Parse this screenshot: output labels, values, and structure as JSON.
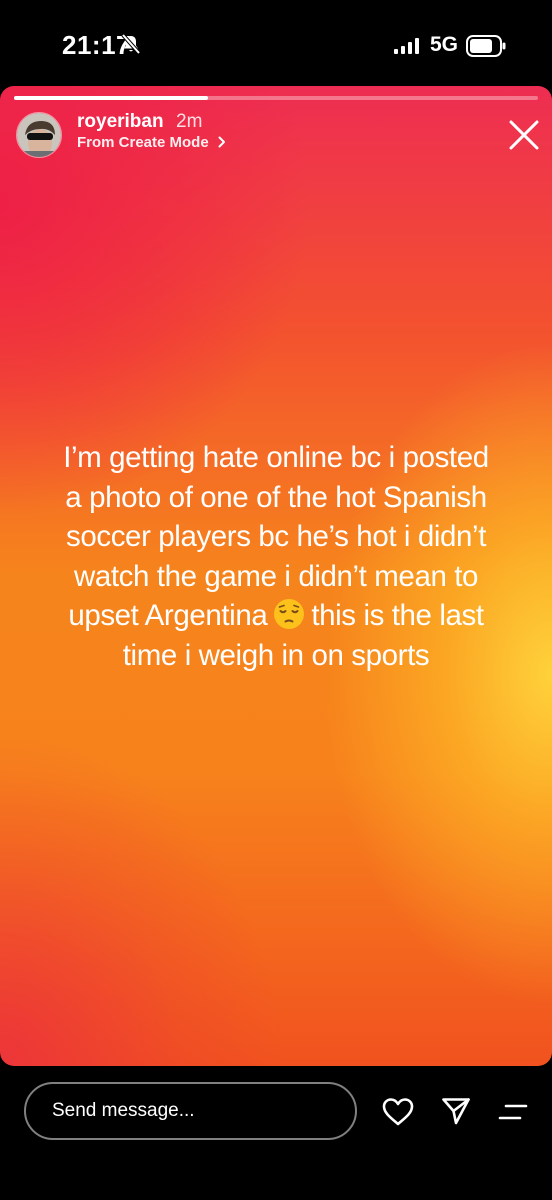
{
  "status_bar": {
    "time": "21:17",
    "network": "5G",
    "icons": [
      "bell-slash-icon",
      "signal-icon",
      "battery-icon"
    ]
  },
  "story": {
    "progress": 0.37,
    "username": "royeriban",
    "time_ago": "2m",
    "create_mode_label": "From Create Mode",
    "text_lines": [
      "I’m getting hate online bc i posted",
      "a photo of one of the hot Spanish",
      "soccer players bc he’s hot i didn’t",
      "watch the game i didn’t mean to",
      "upset Argentina",
      "this is the last",
      "time i weigh in on sports"
    ],
    "emoji": "pensive-face-emoji",
    "colors": {
      "top": "#ee2d52",
      "middle": "#f6841c",
      "highlight": "#ffd63c"
    }
  },
  "bottom_bar": {
    "message_placeholder": "Send message...",
    "icons": [
      "heart-icon",
      "send-icon",
      "more-icon"
    ]
  }
}
